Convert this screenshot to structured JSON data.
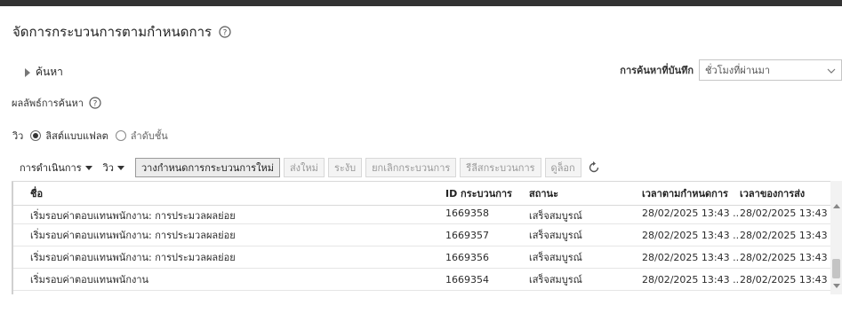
{
  "page": {
    "title": "จัดการกระบวนการตามกำหนดการ"
  },
  "search": {
    "toggle_label": "ค้นหา"
  },
  "saved_search": {
    "label": "การค้นหาที่บันทึก",
    "value": "ชั่วโมงที่ผ่านมา"
  },
  "results": {
    "label": "ผลลัพธ์การค้นหา"
  },
  "view": {
    "label": "วิว",
    "options": [
      {
        "label": "ลิสต์แบบแฟลต",
        "selected": true
      },
      {
        "label": "ลำดับชั้น",
        "selected": false
      }
    ]
  },
  "toolbar": {
    "actions_menu": "การดำเนินการ",
    "view_menu": "วิว",
    "schedule_new": "วางกำหนดการกระบวนการใหม่",
    "resubmit": "ส่งใหม่",
    "hold": "ระงับ",
    "cancel": "ยกเลิกกระบวนการ",
    "release": "รีลีสกระบวนการ",
    "view_log": "ดูล็อก"
  },
  "table": {
    "headers": {
      "name": "ชื่อ",
      "process_id": "ID กระบวนการ",
      "status": "สถานะ",
      "scheduled_time": "เวลาตามกำหนดการ",
      "submission_time": "เวลาของการส่ง"
    },
    "rows": [
      {
        "name": "เริ่มรอบค่าตอบแทนพนักงาน: การประมวลผลย่อย",
        "process_id": "1669358",
        "status": "เสร็จสมบูรณ์",
        "scheduled_time": "28/02/2025 13:43 ...",
        "submission_time": "28/02/2025 13:43 ..."
      },
      {
        "name": "เริ่มรอบค่าตอบแทนพนักงาน: การประมวลผลย่อย",
        "process_id": "1669357",
        "status": "เสร็จสมบูรณ์",
        "scheduled_time": "28/02/2025 13:43 ...",
        "submission_time": "28/02/2025 13:43 ..."
      },
      {
        "name": "เริ่มรอบค่าตอบแทนพนักงาน: การประมวลผลย่อย",
        "process_id": "1669356",
        "status": "เสร็จสมบูรณ์",
        "scheduled_time": "28/02/2025 13:43 ...",
        "submission_time": "28/02/2025 13:43 ..."
      },
      {
        "name": "เริ่มรอบค่าตอบแทนพนักงาน",
        "process_id": "1669354",
        "status": "เสร็จสมบูรณ์",
        "scheduled_time": "28/02/2025 13:43 ...",
        "submission_time": "28/02/2025 13:43 ..."
      }
    ]
  }
}
